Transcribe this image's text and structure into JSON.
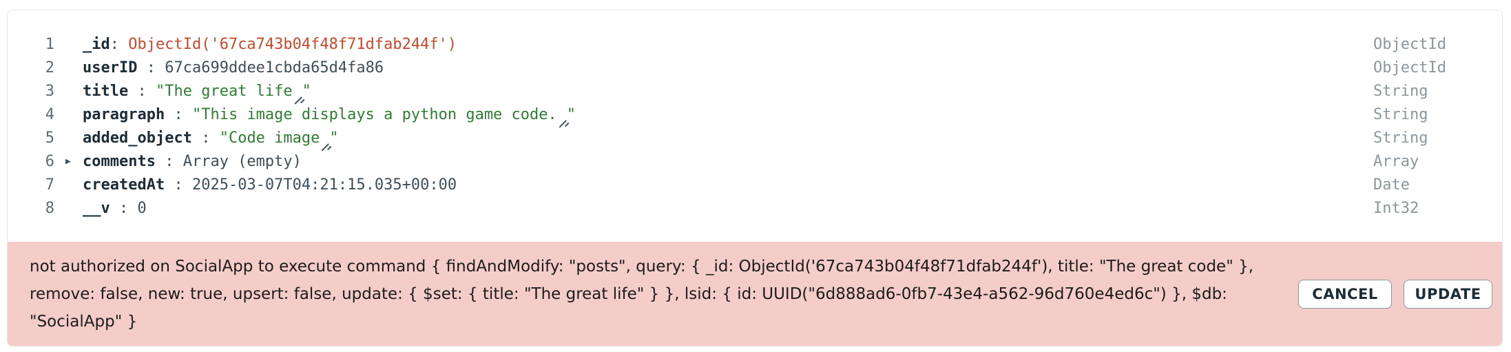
{
  "document": {
    "rows": [
      {
        "line": "1",
        "key": "_id",
        "sep": ": ",
        "value": "ObjectId('67ca743b04f48f71dfab244f')",
        "type": "ObjectId"
      },
      {
        "line": "2",
        "key": "userID",
        "sep": " : ",
        "value": "67ca699ddee1cbda65d4fa86",
        "type": "ObjectId"
      },
      {
        "line": "3",
        "key": "title",
        "sep": " : ",
        "value_prefix": "\"The great life",
        "value_suffix": "\"",
        "type": "String"
      },
      {
        "line": "4",
        "key": "paragraph",
        "sep": " : ",
        "value_prefix": "\"This image displays a python game code.",
        "value_suffix": "\"",
        "type": "String"
      },
      {
        "line": "5",
        "key": "added_object",
        "sep": " : ",
        "value_prefix": "\"Code image",
        "value_suffix": "\"",
        "type": "String"
      },
      {
        "line": "6",
        "key": "comments",
        "sep": " : ",
        "value": "Array (empty)",
        "type": "Array"
      },
      {
        "line": "7",
        "key": "createdAt",
        "sep": " : ",
        "value": "2025-03-07T04:21:15.035+00:00",
        "type": "Date"
      },
      {
        "line": "8",
        "key": "__v",
        "sep": " : ",
        "value": "0",
        "type": "Int32"
      }
    ]
  },
  "error": {
    "message": "not authorized on SocialApp to execute command { findAndModify: \"posts\", query: { _id: ObjectId('67ca743b04f48f71dfab244f'), title: \"The great code\" }, remove: false, new: true, upsert: false, update: { $set: { title: \"The great life\" } }, lsid: { id: UUID(\"6d888ad6-0fb7-43e4-a562-96d760e4ed6c\") }, $db: \"SocialApp\" }"
  },
  "actions": {
    "cancel_label": "CANCEL",
    "update_label": "UPDATE"
  },
  "icons": {
    "expand": "caret-right-icon",
    "resize": "resize-handle-icon"
  },
  "colors": {
    "error_background": "#f5cdc8",
    "objectid_value": "#c94a2b",
    "string_value": "#2e7d32",
    "type_label": "#8a979e"
  }
}
